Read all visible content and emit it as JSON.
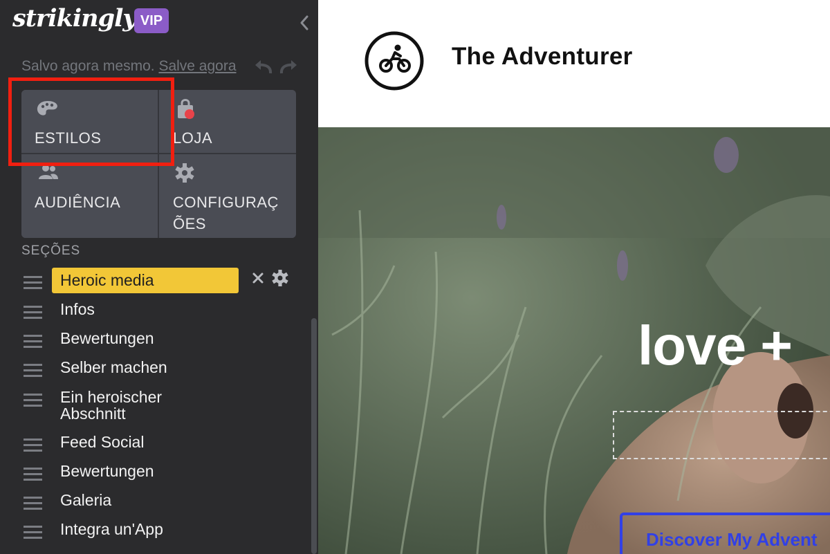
{
  "app": {
    "logo_text": "strikingly",
    "vip_badge": "VIP"
  },
  "status": {
    "saved_text": "Salvo agora mesmo.",
    "save_now_link": "Salve agora"
  },
  "menu": {
    "items": [
      {
        "label": "ESTILOS",
        "icon": "palette-icon"
      },
      {
        "label": "LOJA",
        "icon": "shopping-bag-icon",
        "notification": true
      },
      {
        "label": "AUDIÊNCIA",
        "icon": "audience-icon"
      },
      {
        "label": "CONFIGURAÇ\nÕES",
        "icon": "gear-icon"
      }
    ],
    "highlighted_item": "ESTILOS"
  },
  "sections": {
    "title": "SEÇÕES",
    "items": [
      {
        "label": "Heroic media",
        "active": true
      },
      {
        "label": "Infos"
      },
      {
        "label": "Bewertungen"
      },
      {
        "label": "Selber machen"
      },
      {
        "label": "Ein heroischer Abschnitt"
      },
      {
        "label": "Feed Social"
      },
      {
        "label": "Bewertungen"
      },
      {
        "label": "Galeria"
      },
      {
        "label": "Integra un'App"
      }
    ]
  },
  "preview": {
    "site_title": "The Adventurer",
    "site_logo_icon": "cyclist-icon",
    "hero_heading": "love +",
    "cta_label": "Discover My Advent"
  },
  "colors": {
    "sidebar_bg": "#2b2b2d",
    "menu_tile": "#4a4c54",
    "active_section": "#f2c737",
    "vip_badge": "#8b5cc7",
    "highlight_border": "#f11f10",
    "cta_blue": "#3140e6",
    "notification_dot": "#e8434a"
  }
}
